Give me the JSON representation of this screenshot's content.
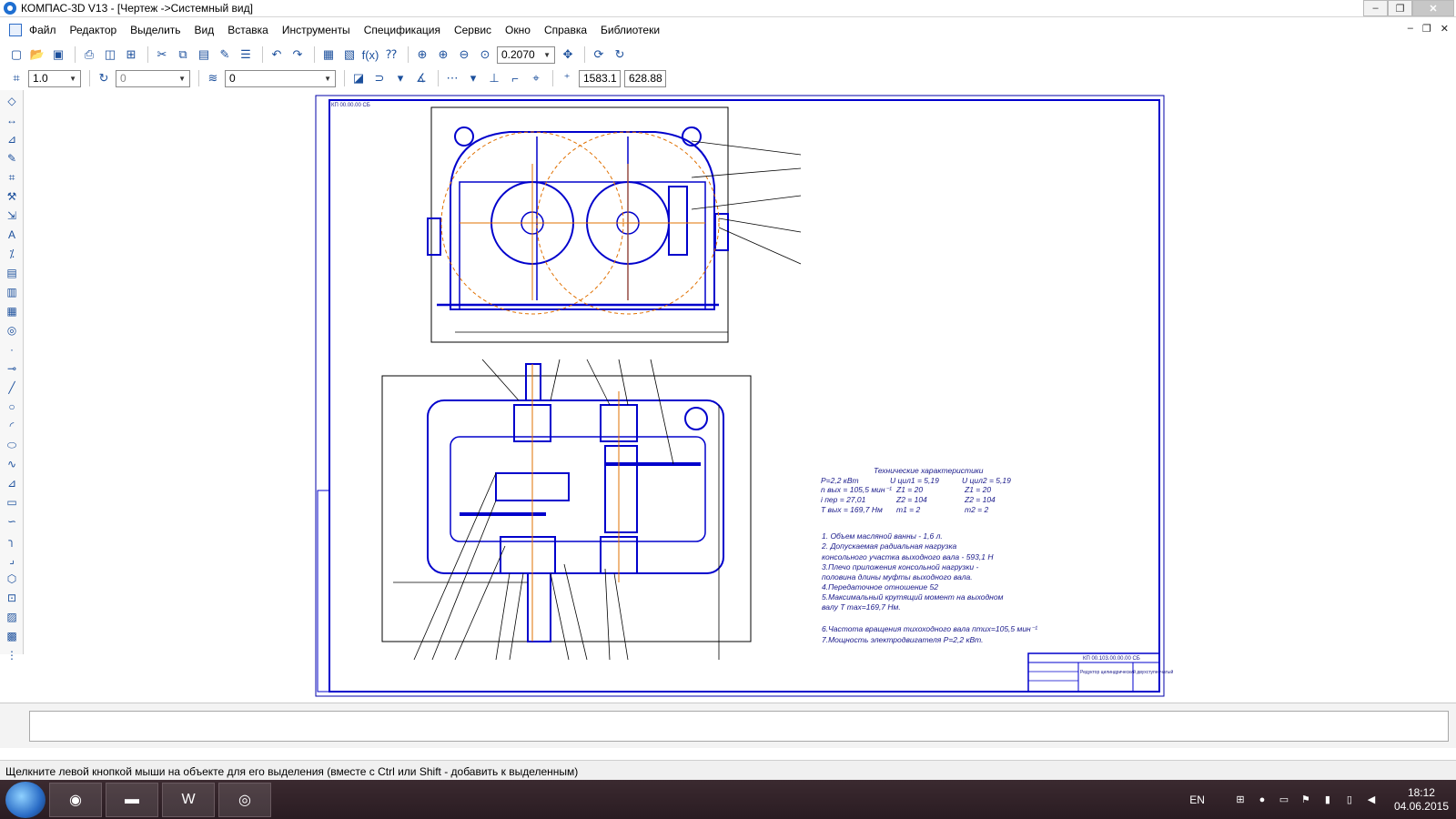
{
  "window": {
    "title": "КОМПАС-3D V13 - [Чертеж ->Системный вид]",
    "minimize": "‒",
    "maximize": "❐",
    "close": "✕"
  },
  "menu": {
    "items": [
      "Файл",
      "Редактор",
      "Выделить",
      "Вид",
      "Вставка",
      "Инструменты",
      "Спецификация",
      "Сервис",
      "Окно",
      "Справка",
      "Библиотеки"
    ],
    "mdi": [
      "‒",
      "❐",
      "✕"
    ]
  },
  "toolbar1": {
    "zoom_value": "0.2070",
    "fx_label": "f(x)"
  },
  "toolbar2": {
    "step_value": "1.0",
    "angle_value": "0",
    "layer_value": "0",
    "coord_x": "1583.1",
    "coord_y": "628.88"
  },
  "drawing": {
    "tech_title": "Технические характеристики",
    "specs": [
      [
        "P=2,2 кВт",
        "U цил1 = 5,19",
        "U цил2 = 5,19"
      ],
      [
        "n вых = 105,5 мин⁻¹",
        "Z1 = 20",
        "Z1 = 20"
      ],
      [
        "i пер = 27,01",
        "Z2 = 104",
        "Z2 = 104"
      ],
      [
        "T вых = 169,7 Нм",
        "m1 = 2",
        "m2 = 2"
      ]
    ],
    "notes": [
      "1. Объем масляной ванны - 1,6 л.",
      "2. Допускаемая радиальная нагрузка",
      "   консольного участка выходного вала - 593,1 Н",
      "3.Плечо приложения консольной нагрузки -",
      "половина длины муфты выходного вала.",
      "4.Передаточное отношение 52",
      "5.Максимальный крутящий момент на выходном",
      "валу T max=169,7 Нм.",
      "6.Частота вращения тихоходного вала птих=105,5 мин⁻¹",
      "7.Мощность электродвигателя P=2,2 кВт."
    ],
    "stamp_code": "КП 00.103.00.00.00 СБ",
    "stamp_name": "Редуктор цилиндрический двухступенчатый",
    "corner_code": "КП 00.00.00 СБ"
  },
  "statusbar": {
    "message": "Щелкните левой кнопкой мыши на объекте для его выделения (вместе с Ctrl или Shift - добавить к выделенным)"
  },
  "taskbar": {
    "lang": "EN",
    "time": "18:12",
    "date": "04.06.2015"
  },
  "colors": {
    "drawing_blue": "#0000cc",
    "center_orange": "#e07000",
    "dim_black": "#000000"
  }
}
